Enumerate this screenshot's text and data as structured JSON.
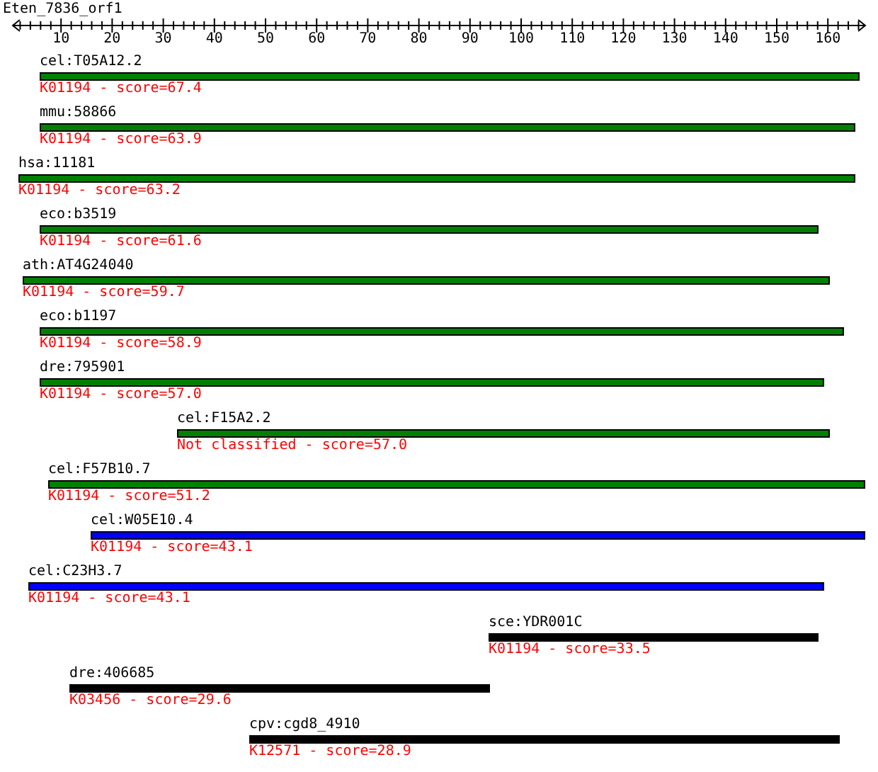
{
  "title": "Eten_7836_orf1",
  "ruler": {
    "labels": [
      "10",
      "20",
      "30",
      "40",
      "50",
      "60",
      "70",
      "80",
      "90",
      "100",
      "110",
      "120",
      "130",
      "140",
      "150",
      "160"
    ]
  },
  "hits": [
    {
      "name": "cel:T05A12.2",
      "annotation": "K01194 - score=67.4",
      "color": "#008000"
    },
    {
      "name": "mmu:58866",
      "annotation": "K01194 - score=63.9",
      "color": "#008000"
    },
    {
      "name": "hsa:11181",
      "annotation": "K01194 - score=63.2",
      "color": "#008000"
    },
    {
      "name": "eco:b3519",
      "annotation": "K01194 - score=61.6",
      "color": "#008000"
    },
    {
      "name": "ath:AT4G24040",
      "annotation": "K01194 - score=59.7",
      "color": "#008000"
    },
    {
      "name": "eco:b1197",
      "annotation": "K01194 - score=58.9",
      "color": "#008000"
    },
    {
      "name": "dre:795901",
      "annotation": "K01194 - score=57.0",
      "color": "#008000"
    },
    {
      "name": "cel:F15A2.2",
      "annotation": "Not classified - score=57.0",
      "color": "#008000"
    },
    {
      "name": "cel:F57B10.7",
      "annotation": "K01194 - score=51.2",
      "color": "#008000"
    },
    {
      "name": "cel:W05E10.4",
      "annotation": "K01194 - score=43.1",
      "color": "#0000ff"
    },
    {
      "name": "cel:C23H3.7",
      "annotation": "K01194 - score=43.1",
      "color": "#0000ff"
    },
    {
      "name": "sce:YDR001C",
      "annotation": "K01194 - score=33.5",
      "color": "#000000"
    },
    {
      "name": "dre:406685",
      "annotation": "K03456 - score=29.6",
      "color": "#000000"
    },
    {
      "name": "cpv:cgd8_4910",
      "annotation": "K12571 - score=28.9",
      "color": "#000000"
    }
  ]
}
